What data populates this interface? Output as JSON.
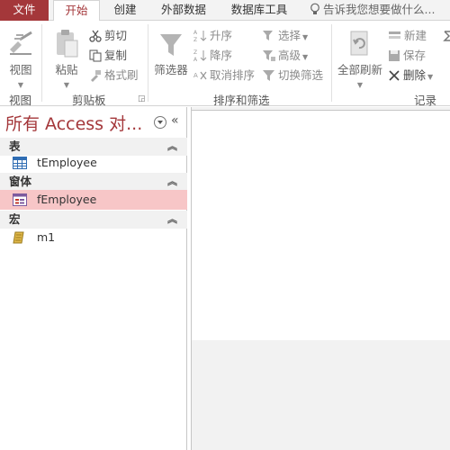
{
  "tabs": {
    "file": "文件",
    "home": "开始",
    "create": "创建",
    "external": "外部数据",
    "dbtools": "数据库工具",
    "tell_me": "告诉我您想要做什么..."
  },
  "ribbon": {
    "views": {
      "view_label": "视图",
      "group_label": "视图"
    },
    "clipboard": {
      "paste_label": "粘贴",
      "cut_label": "剪切",
      "copy_label": "复制",
      "format_painter_label": "格式刷",
      "group_label": "剪贴板"
    },
    "sort_filter": {
      "filter_label": "筛选器",
      "ascending_label": "升序",
      "descending_label": "降序",
      "remove_sort_label": "取消排序",
      "selection_label": "选择",
      "advanced_label": "高级",
      "toggle_filter_label": "切换筛选",
      "group_label": "排序和筛选"
    },
    "records": {
      "refresh_all_label": "全部刷新",
      "new_label": "新建",
      "save_label": "保存",
      "delete_label": "删除",
      "group_label": "记录"
    }
  },
  "nav": {
    "title": "所有 Access 对...",
    "groups": [
      {
        "label": "表",
        "items": [
          {
            "label": "tEmployee",
            "icon": "table-icon"
          }
        ]
      },
      {
        "label": "窗体",
        "items": [
          {
            "label": "fEmployee",
            "icon": "form-icon",
            "selected": true
          }
        ]
      },
      {
        "label": "宏",
        "items": [
          {
            "label": "m1",
            "icon": "macro-icon"
          }
        ]
      }
    ]
  },
  "colors": {
    "accent": "#a4373a",
    "selected_item": "#f7c6c7"
  }
}
